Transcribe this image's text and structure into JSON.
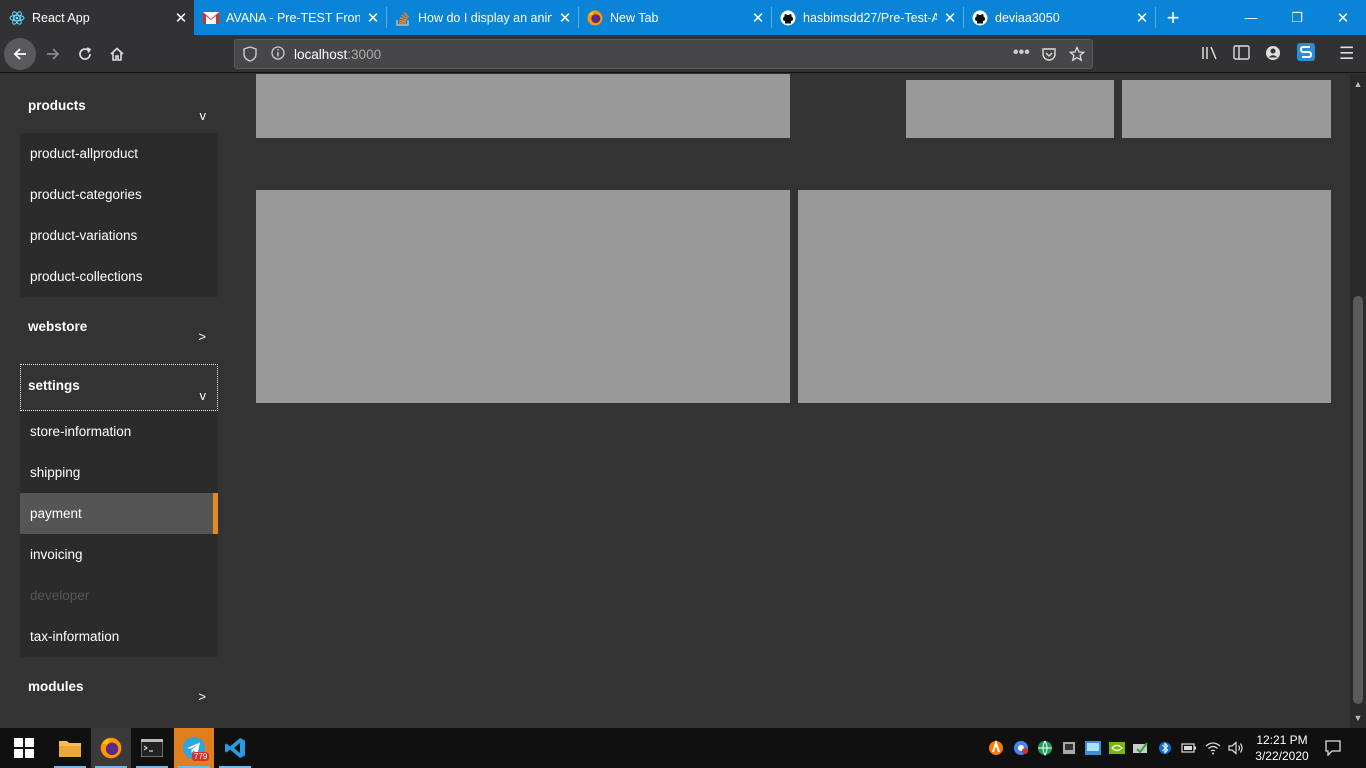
{
  "browser": {
    "tabs": [
      {
        "title": "React App",
        "favicon": "react-icon",
        "active": true
      },
      {
        "title": "AVANA - Pre-TEST Fronte",
        "favicon": "gmail-icon",
        "active": false
      },
      {
        "title": "How do I display an anin",
        "favicon": "stackoverflow-icon",
        "active": false
      },
      {
        "title": "New Tab",
        "favicon": "firefox-icon",
        "active": false
      },
      {
        "title": "hasbimsdd27/Pre-Test-A",
        "favicon": "github-icon",
        "active": false
      },
      {
        "title": "deviaa3050",
        "favicon": "github-icon",
        "active": false
      }
    ],
    "url_host": "localhost",
    "url_port": ":3000"
  },
  "sidebar": {
    "groups": [
      {
        "label": "products",
        "chevron": "v",
        "expanded": true,
        "items": [
          "product-allproduct",
          "product-categories",
          "product-variations",
          "product-collections"
        ]
      },
      {
        "label": "webstore",
        "chevron": ">",
        "expanded": false
      },
      {
        "label": "settings",
        "chevron": "v",
        "expanded": true,
        "items": [
          "store-information",
          "shipping",
          "payment",
          "invoicing",
          "developer",
          "tax-information"
        ]
      },
      {
        "label": "modules",
        "chevron": ">",
        "expanded": false
      }
    ],
    "active_item": "payment",
    "disabled_item": "developer",
    "accent_color": "#e8891f"
  },
  "taskbar": {
    "telegram_badge": "779",
    "time": "12:21 PM",
    "date": "3/22/2020"
  },
  "colors": {
    "tabbar": "#0a84d6",
    "panel": "#999999",
    "background": "#333333"
  }
}
